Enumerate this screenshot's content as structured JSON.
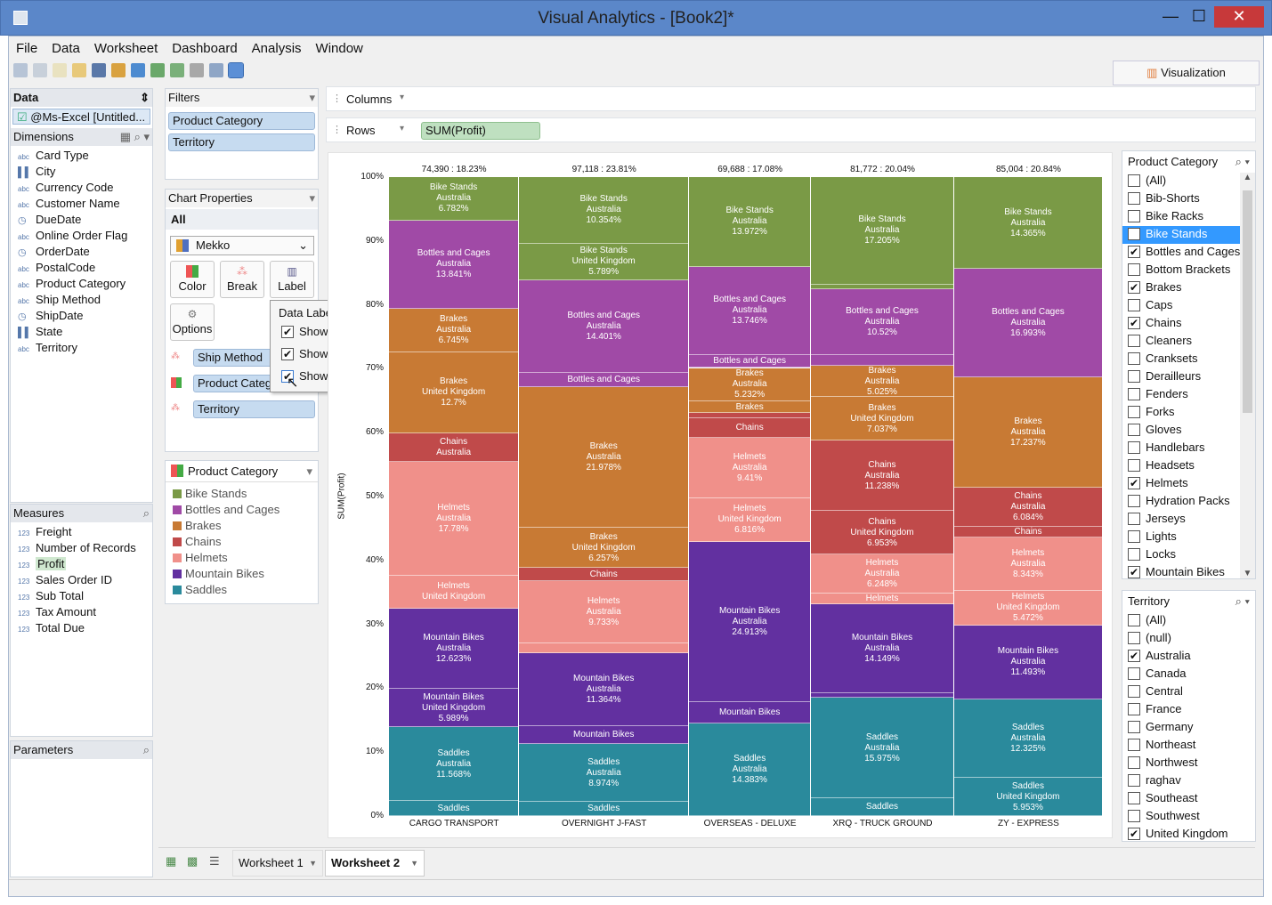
{
  "app": {
    "title": "Visual Analytics - [Book2]*",
    "minimize": "—",
    "maximize": "☐",
    "close": "✕"
  },
  "menu": [
    "File",
    "Data",
    "Worksheet",
    "Dashboard",
    "Analysis",
    "Window"
  ],
  "visualization_button": "Visualization",
  "data_panel": {
    "header": "Data",
    "source": "@Ms-Excel [Untitled...",
    "dimensions_header": "Dimensions",
    "dimensions": [
      {
        "icon": "abc",
        "label": "Card Type"
      },
      {
        "icon": "geo",
        "label": "City"
      },
      {
        "icon": "abc",
        "label": "Currency Code"
      },
      {
        "icon": "abc",
        "label": "Customer Name"
      },
      {
        "icon": "date",
        "label": "DueDate"
      },
      {
        "icon": "abc",
        "label": "Online Order Flag"
      },
      {
        "icon": "date",
        "label": "OrderDate"
      },
      {
        "icon": "abc",
        "label": "PostalCode"
      },
      {
        "icon": "abc",
        "label": "Product Category"
      },
      {
        "icon": "abc",
        "label": "Ship Method"
      },
      {
        "icon": "date",
        "label": "ShipDate"
      },
      {
        "icon": "geo",
        "label": "State"
      },
      {
        "icon": "abc",
        "label": "Territory"
      }
    ],
    "measures_header": "Measures",
    "measures": [
      "Freight",
      "Number of Records",
      "Profit",
      "Sales Order ID",
      "Sub Total",
      "Tax Amount",
      "Total Due"
    ],
    "measure_icon": "123",
    "parameters_header": "Parameters"
  },
  "filters": {
    "header": "Filters",
    "items": [
      "Product Category",
      "Territory"
    ]
  },
  "chart_properties": {
    "header": "Chart Properties",
    "scope": "All",
    "chart_type": "Mekko",
    "buttons": {
      "color": "Color",
      "break": "Break",
      "label": "Label",
      "options": "Options"
    },
    "marks": [
      "Ship Method",
      "Product Categ",
      "Territory"
    ]
  },
  "data_labels_popup": {
    "title": "Data Labels",
    "options": [
      {
        "label": "Show column total",
        "checked": true
      },
      {
        "label": "Show Column percentage",
        "checked": true
      },
      {
        "label": "Show Measure percentage",
        "checked": true
      }
    ]
  },
  "legend": {
    "header": "Product Category",
    "items": [
      {
        "label": "Bike Stands",
        "color": "#7a9a46"
      },
      {
        "label": "Bottles and Cages",
        "color": "#a04aa6"
      },
      {
        "label": "Brakes",
        "color": "#c87a34"
      },
      {
        "label": "Chains",
        "color": "#c04a4a"
      },
      {
        "label": "Helmets",
        "color": "#f0908a"
      },
      {
        "label": "Mountain Bikes",
        "color": "#6230a0"
      },
      {
        "label": "Saddles",
        "color": "#2a8a9c"
      }
    ]
  },
  "shelves": {
    "columns_label": "Columns",
    "rows_label": "Rows",
    "rows_pill": "SUM(Profit)"
  },
  "filter_product_category": {
    "header": "Product Category",
    "items": [
      {
        "label": "(All)",
        "checked": false
      },
      {
        "label": "Bib-Shorts",
        "checked": false
      },
      {
        "label": "Bike Racks",
        "checked": false
      },
      {
        "label": "Bike Stands",
        "checked": true,
        "selected": true
      },
      {
        "label": "Bottles and Cages",
        "checked": true
      },
      {
        "label": "Bottom Brackets",
        "checked": false
      },
      {
        "label": "Brakes",
        "checked": true
      },
      {
        "label": "Caps",
        "checked": false
      },
      {
        "label": "Chains",
        "checked": true
      },
      {
        "label": "Cleaners",
        "checked": false
      },
      {
        "label": "Cranksets",
        "checked": false
      },
      {
        "label": "Derailleurs",
        "checked": false
      },
      {
        "label": "Fenders",
        "checked": false
      },
      {
        "label": "Forks",
        "checked": false
      },
      {
        "label": "Gloves",
        "checked": false
      },
      {
        "label": "Handlebars",
        "checked": false
      },
      {
        "label": "Headsets",
        "checked": false
      },
      {
        "label": "Helmets",
        "checked": true
      },
      {
        "label": "Hydration Packs",
        "checked": false
      },
      {
        "label": "Jerseys",
        "checked": false
      },
      {
        "label": "Lights",
        "checked": false
      },
      {
        "label": "Locks",
        "checked": false
      },
      {
        "label": "Mountain Bikes",
        "checked": true
      }
    ]
  },
  "filter_territory": {
    "header": "Territory",
    "items": [
      {
        "label": "(All)",
        "checked": false
      },
      {
        "label": "(null)",
        "checked": false
      },
      {
        "label": "Australia",
        "checked": true
      },
      {
        "label": "Canada",
        "checked": false
      },
      {
        "label": "Central",
        "checked": false
      },
      {
        "label": "France",
        "checked": false
      },
      {
        "label": "Germany",
        "checked": false
      },
      {
        "label": "Northeast",
        "checked": false
      },
      {
        "label": "Northwest",
        "checked": false
      },
      {
        "label": "raghav",
        "checked": false
      },
      {
        "label": "Southeast",
        "checked": false
      },
      {
        "label": "Southwest",
        "checked": false
      },
      {
        "label": "United Kingdom",
        "checked": true
      }
    ]
  },
  "tabs": [
    "Worksheet 1",
    "Worksheet 2"
  ],
  "active_tab": "Worksheet 2",
  "chart_data": {
    "type": "mekko",
    "ylabel": "SUM(Profit)",
    "yticks": [
      "0%",
      "10%",
      "20%",
      "30%",
      "40%",
      "50%",
      "60%",
      "70%",
      "80%",
      "90%",
      "100%"
    ],
    "columns": [
      {
        "name": "CARGO TRANSPORT",
        "total": "74,390 : 18.23%",
        "share": 18.23,
        "segments": [
          {
            "cat": "Saddles",
            "pct": 2.3,
            "label": [
              "Saddles"
            ]
          },
          {
            "cat": "Saddles",
            "pct": 11.568,
            "label": [
              "Saddles",
              "Australia",
              "11.568%"
            ]
          },
          {
            "cat": "Mountain Bikes",
            "pct": 5.989,
            "label": [
              "Mountain Bikes",
              "United Kingdom",
              "5.989%"
            ]
          },
          {
            "cat": "Mountain Bikes",
            "pct": 12.623,
            "label": [
              "Mountain Bikes",
              "Australia",
              "12.623%"
            ]
          },
          {
            "cat": "Helmets",
            "pct": 5.1,
            "label": [
              "Helmets",
              "United Kingdom"
            ]
          },
          {
            "cat": "Helmets",
            "pct": 17.78,
            "label": [
              "Helmets",
              "Australia",
              "17.78%"
            ]
          },
          {
            "cat": "Chains",
            "pct": 4.5,
            "label": [
              "Chains",
              "Australia"
            ]
          },
          {
            "cat": "Brakes",
            "pct": 12.7,
            "label": [
              "Brakes",
              "United Kingdom",
              "12.7%"
            ]
          },
          {
            "cat": "Brakes",
            "pct": 6.745,
            "label": [
              "Brakes",
              "Australia",
              "6.745%"
            ]
          },
          {
            "cat": "Bottles and Cages",
            "pct": 13.841,
            "label": [
              "Bottles and Cages",
              "Australia",
              "13.841%"
            ]
          },
          {
            "cat": "Bike Stands",
            "pct": 6.782,
            "label": [
              "Bike Stands",
              "Australia",
              "6.782%"
            ]
          }
        ]
      },
      {
        "name": "OVERNIGHT J-FAST",
        "total": "97,118 : 23.81%",
        "share": 23.81,
        "segments": [
          {
            "cat": "Saddles",
            "pct": 2.2,
            "label": [
              "Saddles"
            ]
          },
          {
            "cat": "Saddles",
            "pct": 8.974,
            "label": [
              "Saddles",
              "Australia",
              "8.974%"
            ]
          },
          {
            "cat": "Mountain Bikes",
            "pct": 2.8,
            "label": [
              "Mountain Bikes"
            ]
          },
          {
            "cat": "Mountain Bikes",
            "pct": 11.364,
            "label": [
              "Mountain Bikes",
              "Australia",
              "11.364%"
            ]
          },
          {
            "cat": "Helmets",
            "pct": 1.6,
            "label": []
          },
          {
            "cat": "Helmets",
            "pct": 9.733,
            "label": [
              "Helmets",
              "Australia",
              "9.733%"
            ]
          },
          {
            "cat": "Chains",
            "pct": 2.0,
            "label": [
              "Chains"
            ]
          },
          {
            "cat": "Brakes",
            "pct": 6.257,
            "label": [
              "Brakes",
              "United Kingdom",
              "6.257%"
            ]
          },
          {
            "cat": "Brakes",
            "pct": 21.978,
            "label": [
              "Brakes",
              "Australia",
              "21.978%"
            ]
          },
          {
            "cat": "Bottles and Cages",
            "pct": 2.2,
            "label": [
              "Bottles and Cages"
            ]
          },
          {
            "cat": "Bottles and Cages",
            "pct": 14.401,
            "label": [
              "Bottles and Cages",
              "Australia",
              "14.401%"
            ]
          },
          {
            "cat": "Bike Stands",
            "pct": 5.789,
            "label": [
              "Bike Stands",
              "United Kingdom",
              "5.789%"
            ]
          },
          {
            "cat": "Bike Stands",
            "pct": 10.354,
            "label": [
              "Bike Stands",
              "Australia",
              "10.354%"
            ]
          }
        ]
      },
      {
        "name": "OVERSEAS - DELUXE",
        "total": "69,688 : 17.08%",
        "share": 17.08,
        "segments": [
          {
            "cat": "Saddles",
            "pct": 14.383,
            "label": [
              "Saddles",
              "Australia",
              "14.383%"
            ]
          },
          {
            "cat": "Mountain Bikes",
            "pct": 3.4,
            "label": [
              "Mountain Bikes"
            ]
          },
          {
            "cat": "Mountain Bikes",
            "pct": 24.913,
            "label": [
              "Mountain Bikes",
              "Australia",
              "24.913%"
            ]
          },
          {
            "cat": "Helmets",
            "pct": 6.816,
            "label": [
              "Helmets",
              "United Kingdom",
              "6.816%"
            ]
          },
          {
            "cat": "Helmets",
            "pct": 9.41,
            "label": [
              "Helmets",
              "Australia",
              "9.41%"
            ]
          },
          {
            "cat": "Chains",
            "pct": 3.0,
            "label": [
              "Chains"
            ]
          },
          {
            "cat": "Chains",
            "pct": 0.8,
            "label": []
          },
          {
            "cat": "Brakes",
            "pct": 1.8,
            "label": [
              "Brakes"
            ]
          },
          {
            "cat": "Brakes",
            "pct": 5.232,
            "label": [
              "Brakes",
              "Australia",
              "5.232%"
            ]
          },
          {
            "cat": "Bottles and Cages",
            "pct": 2.0,
            "label": [
              "Bottles and Cages"
            ]
          },
          {
            "cat": "Bottles and Cages",
            "pct": 13.746,
            "label": [
              "Bottles and Cages",
              "Australia",
              "13.746%"
            ]
          },
          {
            "cat": "Bike Stands",
            "pct": 13.972,
            "label": [
              "Bike Stands",
              "Australia",
              "13.972%"
            ]
          }
        ]
      },
      {
        "name": "XRQ - TRUCK GROUND",
        "total": "81,772 : 20.04%",
        "share": 20.04,
        "segments": [
          {
            "cat": "Saddles",
            "pct": 2.9,
            "label": [
              "Saddles"
            ]
          },
          {
            "cat": "Saddles",
            "pct": 15.975,
            "label": [
              "Saddles",
              "Australia",
              "15.975%"
            ]
          },
          {
            "cat": "Mountain Bikes",
            "pct": 0.8,
            "label": []
          },
          {
            "cat": "Mountain Bikes",
            "pct": 14.149,
            "label": [
              "Mountain Bikes",
              "Australia",
              "14.149%"
            ]
          },
          {
            "cat": "Helmets",
            "pct": 1.8,
            "label": [
              "Helmets"
            ]
          },
          {
            "cat": "Helmets",
            "pct": 6.248,
            "label": [
              "Helmets",
              "Australia",
              "6.248%"
            ]
          },
          {
            "cat": "Chains",
            "pct": 6.953,
            "label": [
              "Chains",
              "United Kingdom",
              "6.953%"
            ]
          },
          {
            "cat": "Chains",
            "pct": 11.238,
            "label": [
              "Chains",
              "Australia",
              "11.238%"
            ]
          },
          {
            "cat": "Brakes",
            "pct": 7.037,
            "label": [
              "Brakes",
              "United Kingdom",
              "7.037%"
            ]
          },
          {
            "cat": "Brakes",
            "pct": 5.025,
            "label": [
              "Brakes",
              "Australia",
              "5.025%"
            ]
          },
          {
            "cat": "Bottles and Cages",
            "pct": 1.6,
            "label": []
          },
          {
            "cat": "Bottles and Cages",
            "pct": 10.52,
            "label": [
              "Bottles and Cages",
              "Australia",
              "10.52%"
            ]
          },
          {
            "cat": "Bike Stands",
            "pct": 0.8,
            "label": []
          },
          {
            "cat": "Bike Stands",
            "pct": 17.205,
            "label": [
              "Bike Stands",
              "Australia",
              "17.205%"
            ]
          }
        ]
      },
      {
        "name": "ZY - EXPRESS",
        "total": "85,004 : 20.84%",
        "share": 20.84,
        "segments": [
          {
            "cat": "Saddles",
            "pct": 5.953,
            "label": [
              "Saddles",
              "United Kingdom",
              "5.953%"
            ]
          },
          {
            "cat": "Saddles",
            "pct": 12.325,
            "label": [
              "Saddles",
              "Australia",
              "12.325%"
            ]
          },
          {
            "cat": "Mountain Bikes",
            "pct": 11.493,
            "label": [
              "Mountain Bikes",
              "Australia",
              "11.493%"
            ]
          },
          {
            "cat": "Helmets",
            "pct": 5.472,
            "label": [
              "Helmets",
              "United Kingdom",
              "5.472%"
            ]
          },
          {
            "cat": "Helmets",
            "pct": 8.343,
            "label": [
              "Helmets",
              "Australia",
              "8.343%"
            ]
          },
          {
            "cat": "Chains",
            "pct": 1.6,
            "label": [
              "Chains"
            ]
          },
          {
            "cat": "Chains",
            "pct": 6.084,
            "label": [
              "Chains",
              "Australia",
              "6.084%"
            ]
          },
          {
            "cat": "Brakes",
            "pct": 17.237,
            "label": [
              "Brakes",
              "Australia",
              "17.237%"
            ]
          },
          {
            "cat": "Bottles and Cages",
            "pct": 16.993,
            "label": [
              "Bottles and Cages",
              "Australia",
              "16.993%"
            ]
          },
          {
            "cat": "Bike Stands",
            "pct": 14.365,
            "label": [
              "Bike Stands",
              "Australia",
              "14.365%"
            ]
          }
        ]
      }
    ]
  }
}
